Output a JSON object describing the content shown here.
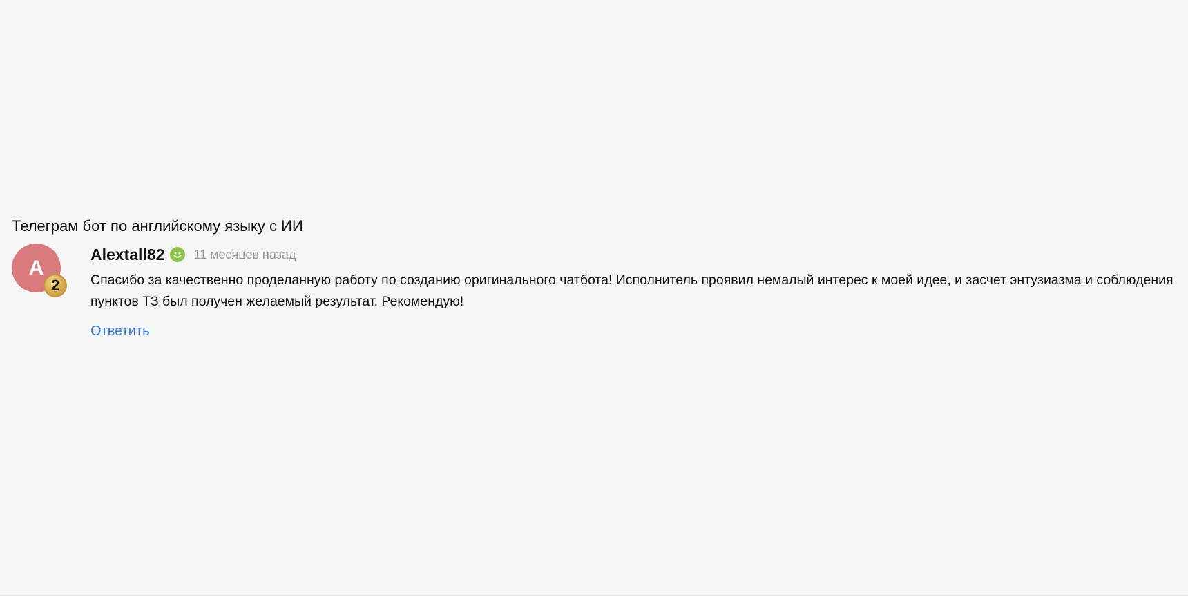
{
  "review_block": {
    "project_title": "Телеграм бот по английскому языку с ИИ",
    "review": {
      "avatar_letter": "A",
      "avatar_color": "#d97a7e",
      "level_badge": "2",
      "author": "Alextall82",
      "status_icon": "smiley-icon",
      "status_color": "#8bc34a",
      "time": "11 месяцев назад",
      "text": "Спасибо за качественно проделанную работу по созданию оригинального чатбота! Исполнитель проявил немалый интерес к моей идее, и засчет энтузиазма и соблюдения пунктов ТЗ был получен желаемый результат. Рекомендую!",
      "reply_label": "Ответить",
      "reply_color": "#3a7bd5"
    }
  }
}
